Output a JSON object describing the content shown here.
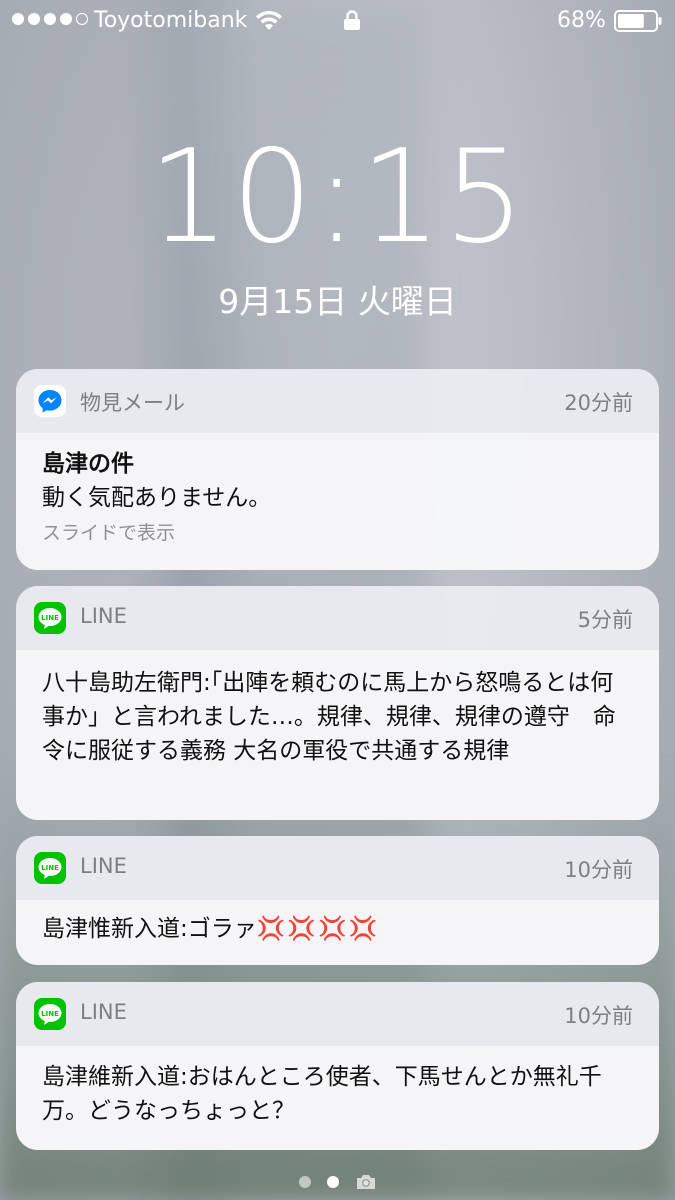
{
  "status_bar": {
    "carrier": "Toyotomibank",
    "battery_percent": "68%",
    "battery_level": 0.68,
    "signal_bars_filled": 4,
    "signal_bars_total": 5
  },
  "lock_screen": {
    "time": "10:15",
    "date": "9月15日 火曜日"
  },
  "notifications": [
    {
      "app": "物見メール",
      "icon": "messenger-icon",
      "time_ago": "20分前",
      "title": "島津の件",
      "body": "動く気配ありません。",
      "hint": "スライドで表示"
    },
    {
      "app": "LINE",
      "icon": "line-icon",
      "time_ago": "5分前",
      "body": "八十島助左衛門:｢出陣を頼むのに馬上から怒鳴るとは何事か」と言われました…。規律、規律、規律の遵守　命令に服従する義務 大名の軍役で共通する規律"
    },
    {
      "app": "LINE",
      "icon": "line-icon",
      "time_ago": "10分前",
      "body": "島津惟新入道:ゴラァ",
      "emoji": "💢💢💢💢"
    },
    {
      "app": "LINE",
      "icon": "line-icon",
      "time_ago": "10分前",
      "body": "島津維新入道:おはんところ使者、下馬せんとか無礼千万。どうなっちょっと？"
    }
  ],
  "colors": {
    "line_green": "#00c300",
    "messenger_blue": "#0084ff",
    "anger_red": "#d52a2a"
  }
}
